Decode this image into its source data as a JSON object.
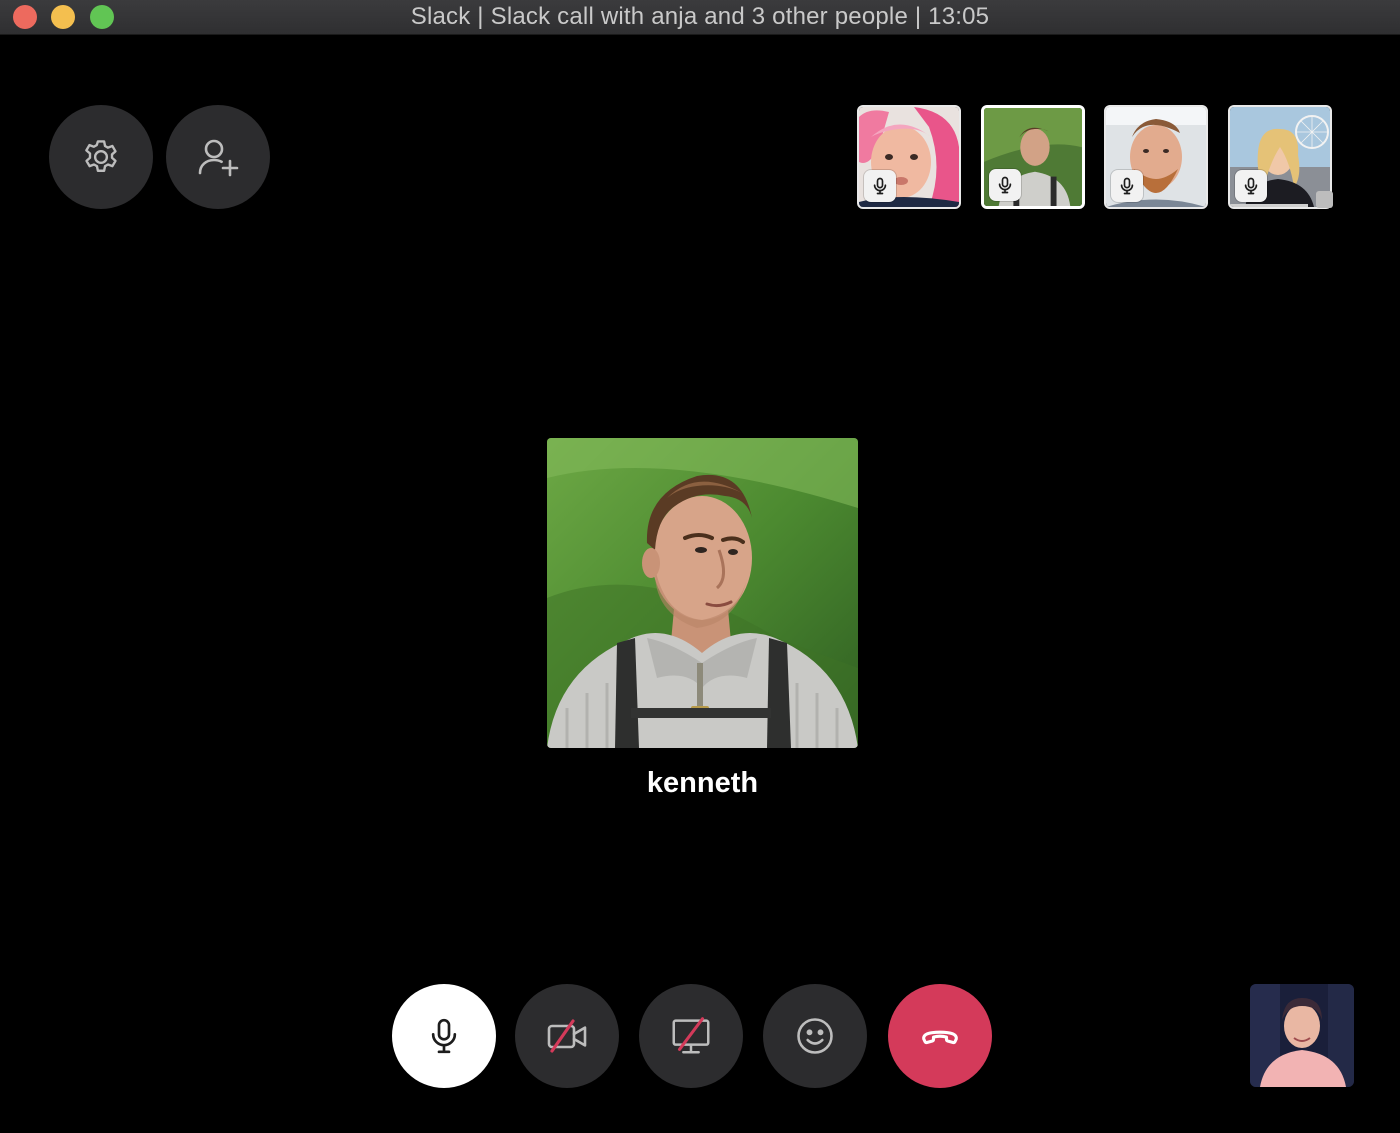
{
  "window": {
    "title": "Slack | Slack call with anja and 3 other people | 13:05"
  },
  "top_controls": {
    "settings_icon": "gear-icon",
    "add_people_icon": "add-user-icon"
  },
  "participants": [
    {
      "muted": false,
      "icon": "microphone-icon"
    },
    {
      "muted": false,
      "icon": "microphone-icon",
      "active": true
    },
    {
      "muted": false,
      "icon": "microphone-icon"
    },
    {
      "muted": false,
      "icon": "microphone-icon"
    }
  ],
  "active_speaker": {
    "name": "kenneth"
  },
  "call_controls": {
    "mic_icon": "microphone-icon",
    "video_icon": "video-off-icon",
    "screen_icon": "screen-share-off-icon",
    "emoji_icon": "emoji-icon",
    "hangup_icon": "hang-up-icon"
  },
  "colors": {
    "background": "#000000",
    "button": "#2c2c2e",
    "hangup": "#d43a5a",
    "mic_active": "#ffffff",
    "strike": "#d43a5a"
  }
}
